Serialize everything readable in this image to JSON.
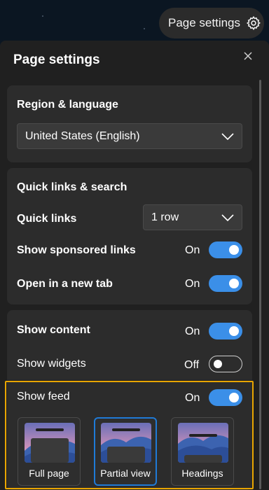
{
  "top_button": {
    "label": "Page settings",
    "icon": "gear-icon"
  },
  "panel": {
    "title": "Page settings",
    "close_icon": "close-icon",
    "region": {
      "heading": "Region & language",
      "selected": "United States (English)"
    },
    "quick_links_section": {
      "heading": "Quick links & search",
      "quick_links": {
        "label": "Quick links",
        "selected": "1 row"
      },
      "sponsored": {
        "label": "Show sponsored links",
        "state": "On",
        "enabled": true
      },
      "new_tab": {
        "label": "Open in a new tab",
        "state": "On",
        "enabled": true
      }
    },
    "content_section": {
      "show_content": {
        "label": "Show content",
        "state": "On",
        "enabled": true
      },
      "show_widgets": {
        "label": "Show widgets",
        "state": "Off",
        "enabled": false
      },
      "show_feed": {
        "label": "Show feed",
        "state": "On",
        "enabled": true
      },
      "layouts": [
        {
          "label": "Full page",
          "selected": false
        },
        {
          "label": "Partial view",
          "selected": true
        },
        {
          "label": "Headings",
          "selected": false
        }
      ]
    }
  },
  "colors": {
    "accent": "#3b8fe8",
    "selected_border": "#1f7ad6",
    "highlight": "#e8a500",
    "panel_bg": "#202020",
    "card_bg": "#2c2c2c"
  }
}
